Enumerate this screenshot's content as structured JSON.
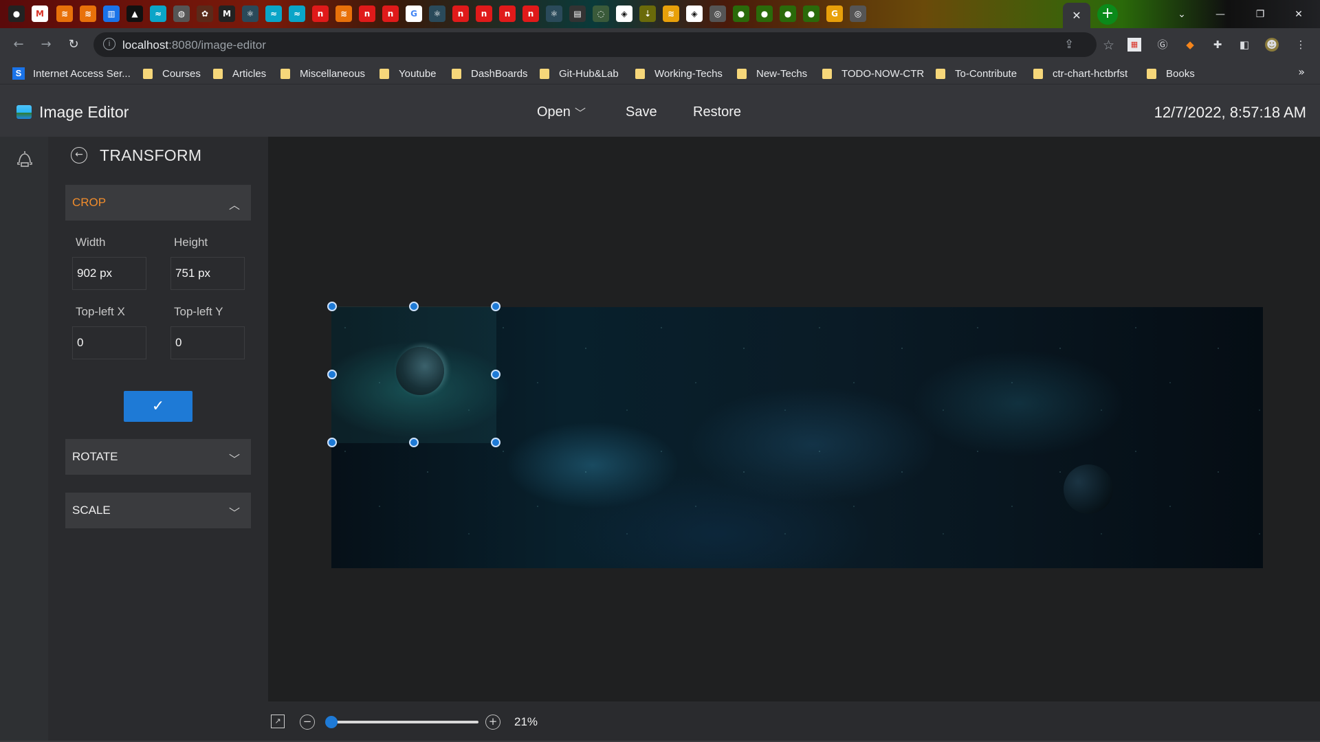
{
  "browser": {
    "address_host": "localhost",
    "address_path": ":8080/image-editor",
    "active_tab_close": "✕",
    "new_tab": "+",
    "window_controls": {
      "minimize": "—",
      "restore": "❐",
      "close": "✕"
    }
  },
  "bookmarks": [
    {
      "label": "Internet Access Ser...",
      "icon": "site-s-icon"
    },
    {
      "label": "Courses",
      "icon": "folder-icon"
    },
    {
      "label": "Articles",
      "icon": "folder-icon"
    },
    {
      "label": "Miscellaneous",
      "icon": "folder-icon"
    },
    {
      "label": "Youtube",
      "icon": "folder-icon"
    },
    {
      "label": "DashBoards",
      "icon": "folder-icon"
    },
    {
      "label": "Git-Hub&Lab",
      "icon": "folder-icon"
    },
    {
      "label": "Working-Techs",
      "icon": "folder-icon"
    },
    {
      "label": "New-Techs",
      "icon": "folder-icon"
    },
    {
      "label": "TODO-NOW-CTR",
      "icon": "folder-icon"
    },
    {
      "label": "To-Contribute",
      "icon": "folder-icon"
    },
    {
      "label": "ctr-chart-hctbrfst",
      "icon": "folder-icon"
    },
    {
      "label": "Books",
      "icon": "folder-icon"
    }
  ],
  "bookmarks_more": "»",
  "header": {
    "app_title": "Image Editor",
    "nav": {
      "open": "Open",
      "save": "Save",
      "restore": "Restore"
    },
    "datetime": "12/7/2022, 8:57:18 AM"
  },
  "panel": {
    "title": "TRANSFORM",
    "crop": {
      "label": "CROP",
      "width_label": "Width",
      "width_value": "902 px",
      "height_label": "Height",
      "height_value": "751 px",
      "x_label": "Top-left X",
      "x_value": "0",
      "y_label": "Top-left Y",
      "y_value": "0",
      "apply_icon": "✓"
    },
    "rotate": {
      "label": "ROTATE"
    },
    "scale": {
      "label": "SCALE"
    }
  },
  "zoom": {
    "minus": "−",
    "plus": "+",
    "value": "21%",
    "level": 0.02
  },
  "colors": {
    "accent": "#1e7ad6",
    "crop_label": "#f08c2c",
    "panel_bg": "#2a2b2e"
  }
}
